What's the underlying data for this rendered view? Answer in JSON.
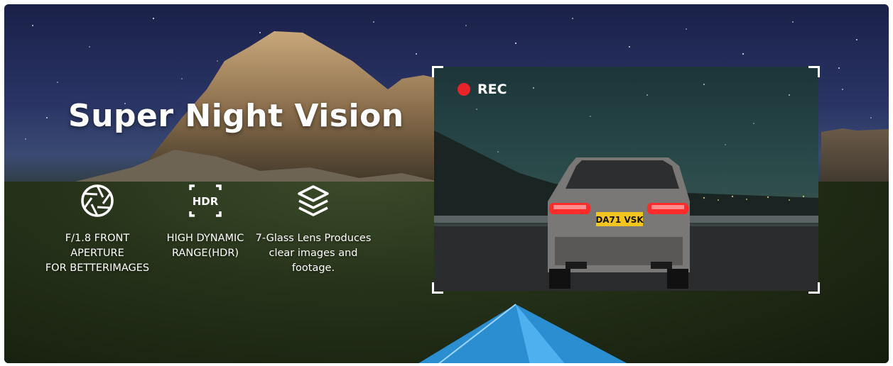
{
  "banner": {
    "title": "Super Night Vision"
  },
  "features": [
    {
      "icon": "aperture-icon",
      "lines": [
        "F/1.8 FRONT",
        "APERTURE",
        "FOR BETTERIMAGES"
      ]
    },
    {
      "icon": "hdr-icon",
      "icon_text": "HDR",
      "lines": [
        "HIGH DYNAMIC",
        "RANGE(HDR)"
      ]
    },
    {
      "icon": "layers-icon",
      "lines": [
        "7-Glass Lens Produces",
        "clear images and",
        "footage."
      ]
    }
  ],
  "viewer": {
    "rec_label": "REC",
    "plate": "DA71 VSK",
    "rec_color": "#e8232a"
  },
  "colors": {
    "sky": "#1a2048",
    "text": "#ffffff",
    "taillight": "#ff2a2a",
    "plate": "#f2c61f"
  }
}
